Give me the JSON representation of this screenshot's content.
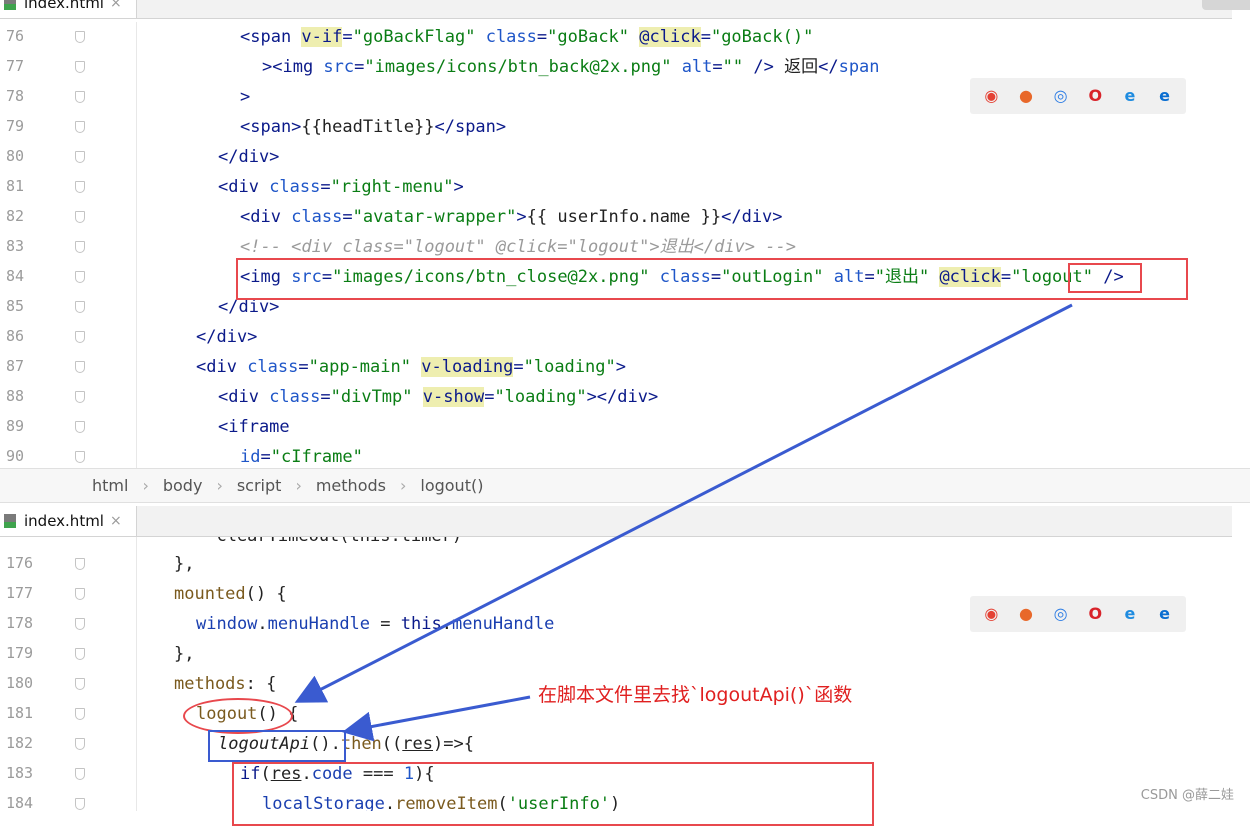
{
  "top_pane": {
    "tab_label": "index.html",
    "tab_close": "×",
    "lines": [
      {
        "num": "76",
        "indent": 240,
        "segments": [
          [
            "tg",
            "<span "
          ],
          [
            "vh",
            "v-if"
          ],
          [
            "tg",
            "="
          ],
          [
            "st",
            "\"goBackFlag\""
          ],
          [
            "tg",
            " "
          ],
          [
            "at",
            "class"
          ],
          [
            "tg",
            "="
          ],
          [
            "st",
            "\"goBack\""
          ],
          [
            "tg",
            " "
          ],
          [
            "vh",
            "@click"
          ],
          [
            "tg",
            "="
          ],
          [
            "st",
            "\"goBack()\""
          ]
        ]
      },
      {
        "num": "77",
        "indent": 262,
        "segments": [
          [
            "tg",
            "><img "
          ],
          [
            "at",
            "src"
          ],
          [
            "tg",
            "="
          ],
          [
            "st",
            "\"images/icons/btn_back@2x.png\""
          ],
          [
            "tg",
            " "
          ],
          [
            "at",
            "alt"
          ],
          [
            "tg",
            "="
          ],
          [
            "st",
            "\"\""
          ],
          [
            "tg",
            " /> "
          ],
          [
            "pl",
            "返回"
          ],
          [
            "tg",
            "</"
          ],
          [
            "at",
            "span"
          ]
        ]
      },
      {
        "num": "78",
        "indent": 240,
        "segments": [
          [
            "tg",
            ">"
          ]
        ]
      },
      {
        "num": "79",
        "indent": 240,
        "segments": [
          [
            "tg",
            "<span>"
          ],
          [
            "pl",
            "{{headTitle}}"
          ],
          [
            "tg",
            "</span>"
          ]
        ]
      },
      {
        "num": "80",
        "indent": 218,
        "segments": [
          [
            "tg",
            "</div>"
          ]
        ]
      },
      {
        "num": "81",
        "indent": 218,
        "segments": [
          [
            "tg",
            "<div "
          ],
          [
            "at",
            "class"
          ],
          [
            "tg",
            "="
          ],
          [
            "st",
            "\"right-menu\""
          ],
          [
            "tg",
            ">"
          ]
        ]
      },
      {
        "num": "82",
        "indent": 240,
        "segments": [
          [
            "tg",
            "<div "
          ],
          [
            "at",
            "class"
          ],
          [
            "tg",
            "="
          ],
          [
            "st",
            "\"avatar-wrapper\""
          ],
          [
            "tg",
            ">"
          ],
          [
            "pl",
            "{{ userInfo.name }}"
          ],
          [
            "tg",
            "</div>"
          ]
        ]
      },
      {
        "num": "83",
        "indent": 240,
        "segments": [
          [
            "cm",
            "<!-- <div class=\"logout\" @click=\"logout\">退出</div> -->"
          ]
        ]
      },
      {
        "num": "84",
        "indent": 240,
        "segments": [
          [
            "tg",
            "<img "
          ],
          [
            "at",
            "src"
          ],
          [
            "tg",
            "="
          ],
          [
            "st",
            "\"images/icons/btn_close@2x.png\""
          ],
          [
            "tg",
            " "
          ],
          [
            "at",
            "class"
          ],
          [
            "tg",
            "="
          ],
          [
            "st",
            "\"outLogin\""
          ],
          [
            "tg",
            " "
          ],
          [
            "at",
            "alt"
          ],
          [
            "tg",
            "="
          ],
          [
            "st",
            "\"退出\""
          ],
          [
            "tg",
            " "
          ],
          [
            "vh",
            "@click"
          ],
          [
            "tg",
            "="
          ],
          [
            "st",
            "\"logout\""
          ],
          [
            "tg",
            " />"
          ]
        ]
      },
      {
        "num": "85",
        "indent": 218,
        "segments": [
          [
            "tg",
            "</div>"
          ]
        ]
      },
      {
        "num": "86",
        "indent": 196,
        "segments": [
          [
            "tg",
            "</div>"
          ]
        ]
      },
      {
        "num": "87",
        "indent": 196,
        "segments": [
          [
            "tg",
            "<div "
          ],
          [
            "at",
            "class"
          ],
          [
            "tg",
            "="
          ],
          [
            "st",
            "\"app-main\""
          ],
          [
            "tg",
            " "
          ],
          [
            "vh",
            "v-loading"
          ],
          [
            "tg",
            "="
          ],
          [
            "st",
            "\"loading\""
          ],
          [
            "tg",
            ">"
          ]
        ]
      },
      {
        "num": "88",
        "indent": 218,
        "segments": [
          [
            "tg",
            "<div "
          ],
          [
            "at",
            "class"
          ],
          [
            "tg",
            "="
          ],
          [
            "st",
            "\"divTmp\""
          ],
          [
            "tg",
            " "
          ],
          [
            "vh",
            "v-show"
          ],
          [
            "tg",
            "="
          ],
          [
            "st",
            "\"loading\""
          ],
          [
            "tg",
            "></div>"
          ]
        ]
      },
      {
        "num": "89",
        "indent": 218,
        "segments": [
          [
            "tg",
            "<iframe"
          ]
        ]
      },
      {
        "num": "90",
        "indent": 240,
        "segments": [
          [
            "at",
            "id"
          ],
          [
            "tg",
            "="
          ],
          [
            "st",
            "\"cIframe\""
          ]
        ]
      }
    ]
  },
  "breadcrumb": [
    "html",
    "body",
    "script",
    "methods",
    "logout()"
  ],
  "breadcrumb_sep": "›",
  "bottom_pane": {
    "tab_label": "index.html",
    "tab_close": "×",
    "lines": [
      {
        "num": "176",
        "indent": 174,
        "segments": [
          [
            "pl",
            "},"
          ]
        ]
      },
      {
        "num": "177",
        "indent": 174,
        "segments": [
          [
            "fn",
            "mounted"
          ],
          [
            "pl",
            "() {"
          ]
        ]
      },
      {
        "num": "178",
        "indent": 196,
        "segments": [
          [
            "mt",
            "window"
          ],
          [
            "pl",
            "."
          ],
          [
            "mt",
            "menuHandle"
          ],
          [
            "pl",
            " = "
          ],
          [
            "ky",
            "this"
          ],
          [
            "pl",
            "."
          ],
          [
            "mt",
            "menuHandle"
          ]
        ]
      },
      {
        "num": "179",
        "indent": 174,
        "segments": [
          [
            "pl",
            "},"
          ]
        ]
      },
      {
        "num": "180",
        "indent": 174,
        "segments": [
          [
            "fn",
            "methods"
          ],
          [
            "pl",
            ": {"
          ]
        ]
      },
      {
        "num": "181",
        "indent": 196,
        "segments": [
          [
            "fn",
            "logout"
          ],
          [
            "pl",
            "() {"
          ]
        ]
      },
      {
        "num": "182",
        "indent": 218,
        "segments": [
          [
            "it",
            "logoutApi"
          ],
          [
            "pl",
            "()."
          ],
          [
            "fn",
            "then"
          ],
          [
            "pl",
            "(("
          ],
          [
            "ul",
            "res"
          ],
          [
            "pl",
            ")=>{"
          ]
        ]
      },
      {
        "num": "183",
        "indent": 240,
        "segments": [
          [
            "ky",
            "if"
          ],
          [
            "pl",
            "("
          ],
          [
            "ul",
            "res"
          ],
          [
            "pl",
            "."
          ],
          [
            "mt",
            "code"
          ],
          [
            "pl",
            " === "
          ],
          [
            "nu",
            "1"
          ],
          [
            "pl",
            "){"
          ]
        ]
      },
      {
        "num": "184",
        "indent": 262,
        "segments": [
          [
            "mt",
            "localStorage"
          ],
          [
            "pl",
            "."
          ],
          [
            "fn",
            "removeItem"
          ],
          [
            "pl",
            "("
          ],
          [
            "st",
            "'userInfo'"
          ],
          [
            "pl",
            ")"
          ]
        ]
      }
    ]
  },
  "annotation": "在脚本文件里去找`logoutApi()`函数",
  "browsers": [
    {
      "name": "chrome-icon",
      "glyph": "◉",
      "color": "#e44134"
    },
    {
      "name": "firefox-icon",
      "glyph": "●",
      "color": "#e8682a"
    },
    {
      "name": "safari-icon",
      "glyph": "◎",
      "color": "#2a7be4"
    },
    {
      "name": "opera-icon",
      "glyph": "O",
      "color": "#d8232a"
    },
    {
      "name": "ie-icon",
      "glyph": "e",
      "color": "#1f8ce0"
    },
    {
      "name": "edge-icon",
      "glyph": "e",
      "color": "#0a6ed1"
    }
  ],
  "watermark": "CSDN @薛二娃",
  "colors": {
    "annotation_red": "#e8484d",
    "annotation_blue": "#3a5bd0"
  }
}
